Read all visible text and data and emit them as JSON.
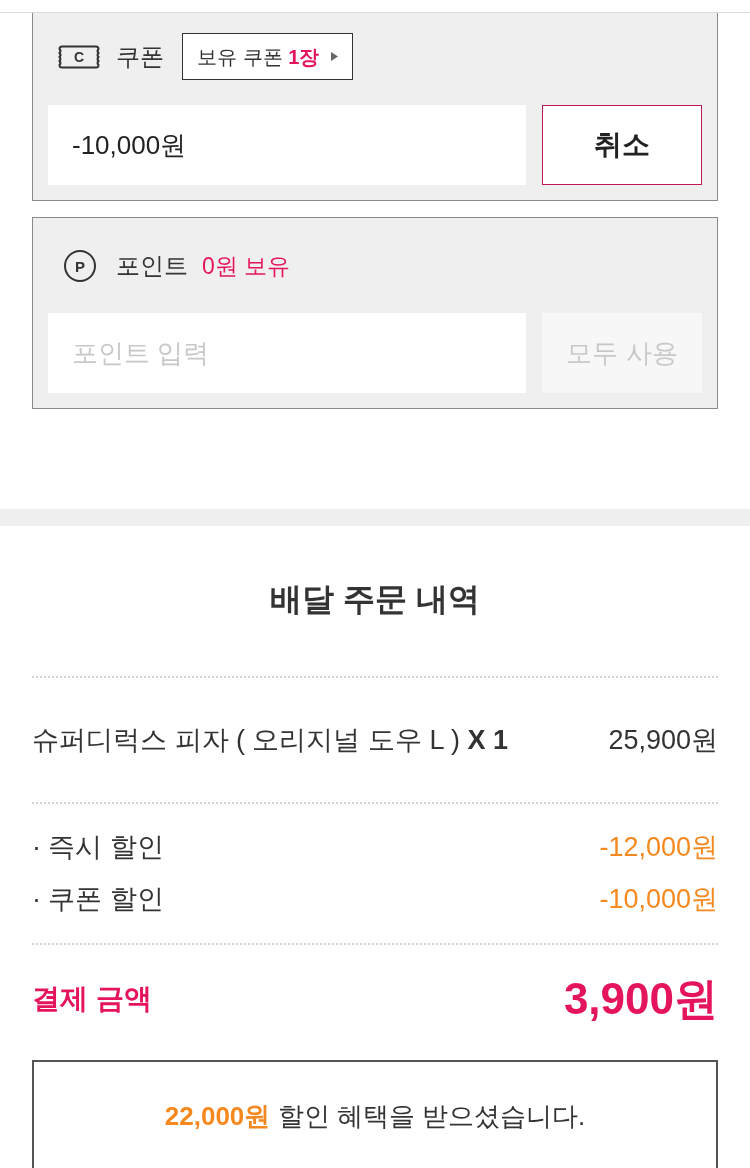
{
  "coupon": {
    "icon_letter": "C",
    "label": "쿠폰",
    "owned_badge": "보유 쿠폰 **1장**",
    "field": {
      "value": "-10,000원"
    },
    "button": {
      "label": "취소",
      "disabled": false
    }
  },
  "points": {
    "icon_letter": "P",
    "label": "포인트",
    "balance": "0원 보유",
    "field": {
      "placeholder": "포인트 입력"
    },
    "button": {
      "label": "모두 사용",
      "disabled": true
    }
  },
  "order_summary": {
    "title": "배달 주문 내역",
    "items": [
      {
        "name": "슈퍼디럭스 피자 ( 오리지널 도우 L ) **X 1**",
        "price": "25,900원"
      }
    ],
    "discounts": [
      {
        "label": "· 즉시 할인",
        "amount": "-12,000원"
      },
      {
        "label": "· 쿠폰 할인",
        "amount": "-10,000원"
      }
    ],
    "total": {
      "label": "결제 금액",
      "amount": "3,900원"
    },
    "benefit_notice": "**22,000원** 할인 혜택을 받으셨습니다."
  }
}
